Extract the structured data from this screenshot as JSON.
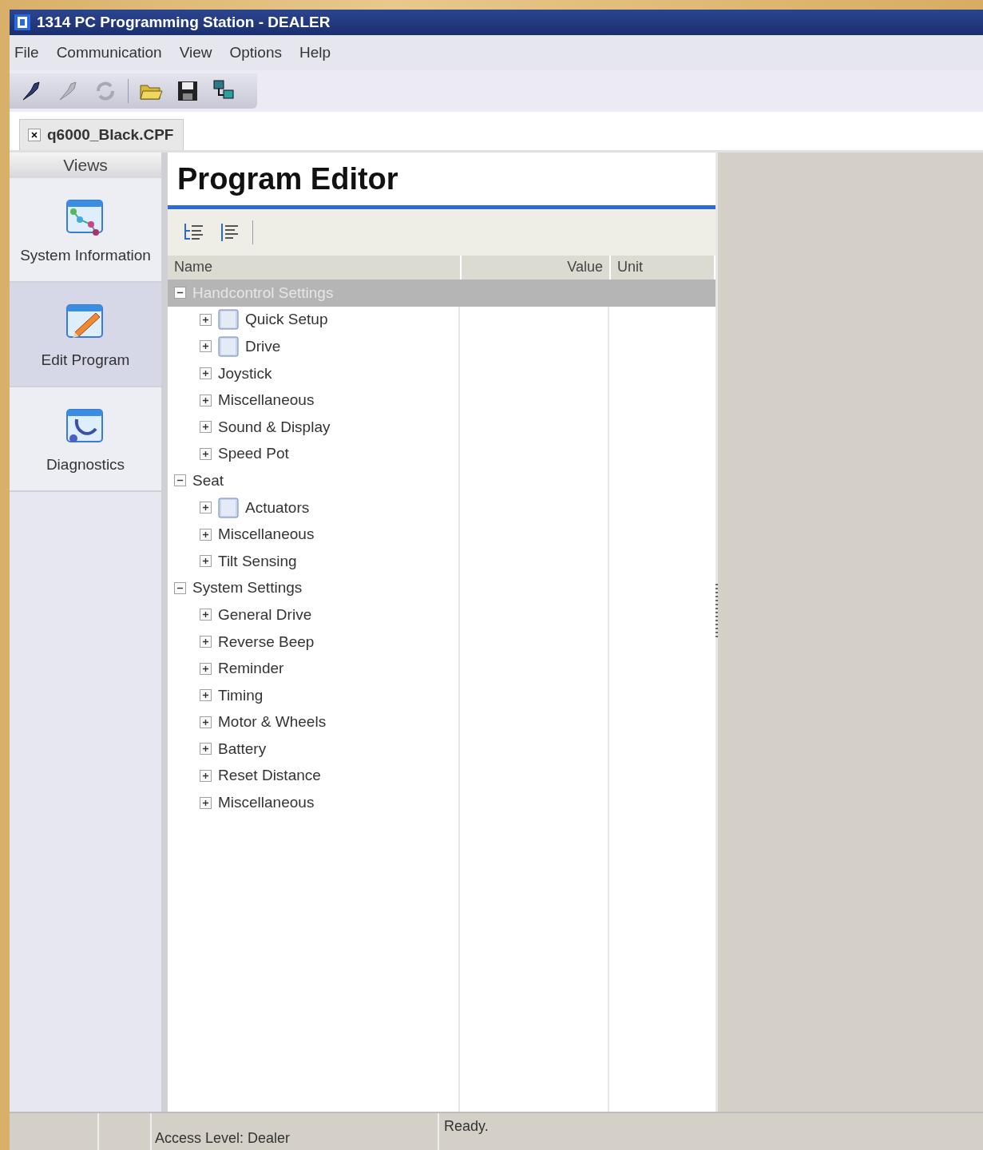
{
  "window": {
    "title": "1314 PC Programming Station - DEALER"
  },
  "menu": [
    "File",
    "Communication",
    "View",
    "Options",
    "Help"
  ],
  "document_tab": {
    "label": "q6000_Black.CPF",
    "selected": true
  },
  "views": {
    "title": "Views",
    "items": [
      {
        "label": "System Information",
        "kind": "sysinfo",
        "selected": false
      },
      {
        "label": "Edit Program",
        "kind": "edit",
        "selected": true
      },
      {
        "label": "Diagnostics",
        "kind": "diag",
        "selected": false
      }
    ]
  },
  "editor": {
    "title": "Program Editor",
    "columns": [
      "Name",
      "Value",
      "Unit"
    ],
    "tree": [
      {
        "label": "Handcontrol Settings",
        "expanded": true,
        "selected": true,
        "children": [
          {
            "label": "Quick Setup",
            "kind": "page",
            "expanded": false
          },
          {
            "label": "Drive",
            "kind": "page",
            "expanded": false
          },
          {
            "label": "Joystick",
            "kind": "plain",
            "expanded": false
          },
          {
            "label": "Miscellaneous",
            "kind": "plain",
            "expanded": false
          },
          {
            "label": "Sound & Display",
            "kind": "plain",
            "expanded": false
          },
          {
            "label": "Speed Pot",
            "kind": "plain",
            "expanded": false
          }
        ]
      },
      {
        "label": "Seat",
        "expanded": true,
        "selected": false,
        "children": [
          {
            "label": "Actuators",
            "kind": "page",
            "expanded": false
          },
          {
            "label": "Miscellaneous",
            "kind": "plain",
            "expanded": false
          },
          {
            "label": "Tilt Sensing",
            "kind": "plain",
            "expanded": false
          }
        ]
      },
      {
        "label": "System Settings",
        "expanded": true,
        "selected": false,
        "children": [
          {
            "label": "General Drive",
            "kind": "plain",
            "expanded": false
          },
          {
            "label": "Reverse Beep",
            "kind": "plain",
            "expanded": false
          },
          {
            "label": "Reminder",
            "kind": "plain",
            "expanded": false
          },
          {
            "label": "Timing",
            "kind": "plain",
            "expanded": false
          },
          {
            "label": "Motor & Wheels",
            "kind": "plain",
            "expanded": false
          },
          {
            "label": "Battery",
            "kind": "plain",
            "expanded": false
          },
          {
            "label": "Reset Distance",
            "kind": "plain",
            "expanded": false
          },
          {
            "label": "Miscellaneous",
            "kind": "plain",
            "expanded": false
          }
        ]
      }
    ]
  },
  "status_bar": {
    "access": "Access Level: Dealer",
    "message": "Ready."
  }
}
